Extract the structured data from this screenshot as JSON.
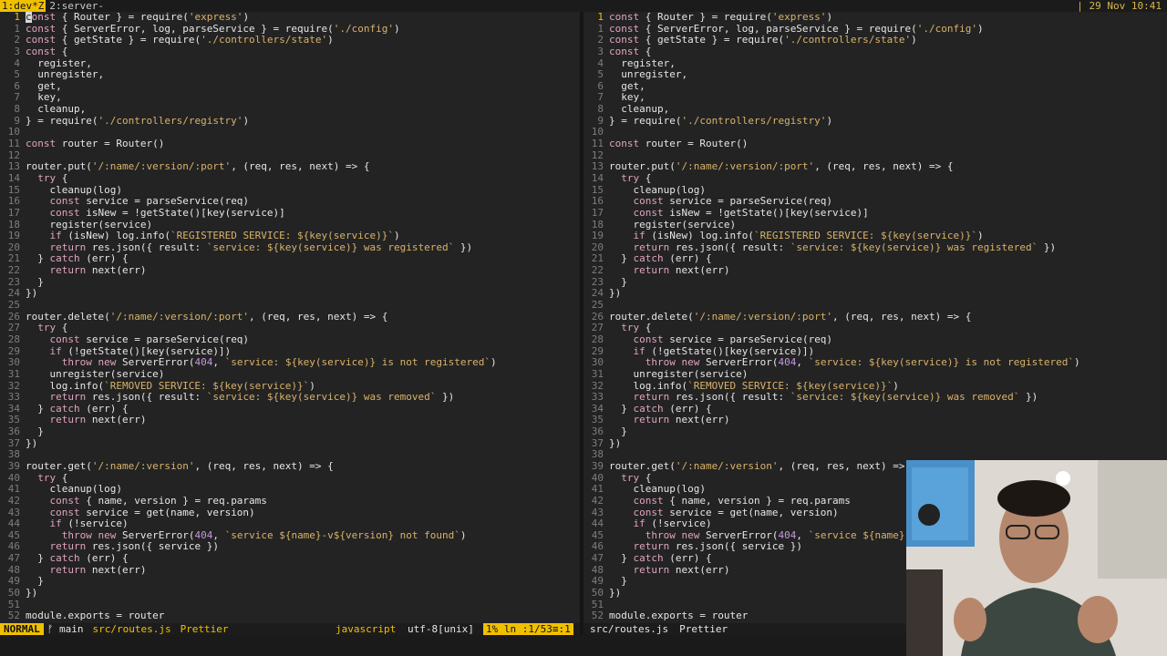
{
  "tmux": {
    "active_window": "1:dev*Z",
    "other_window": "2:server-",
    "date": "| 29 Nov 10:41"
  },
  "left": {
    "status": {
      "mode": "NORMAL",
      "branch": "ᚠ main",
      "file": "src/routes.js",
      "formatter": "Prettier",
      "filetype": "javascript",
      "encoding": "utf-8[unix]",
      "position": "1% ln :1/53≡:1"
    }
  },
  "right": {
    "status": {
      "file": "src/routes.js",
      "formatter": "Prettier"
    }
  },
  "code": [
    {
      "n": "1",
      "t": "const { Router } = require('express')"
    },
    {
      "n": "2",
      "t": "const { ServerError, log, parseService } = require('./config')"
    },
    {
      "n": "3",
      "t": "const { getState } = require('./controllers/state')"
    },
    {
      "n": "4",
      "t": "const {"
    },
    {
      "n": "5",
      "t": "  register,"
    },
    {
      "n": "6",
      "t": "  unregister,"
    },
    {
      "n": "7",
      "t": "  get,"
    },
    {
      "n": "8",
      "t": "  key,"
    },
    {
      "n": "9",
      "t": "  cleanup,"
    },
    {
      "n": "10",
      "t": "} = require('./controllers/registry')"
    },
    {
      "n": "11",
      "t": ""
    },
    {
      "n": "12",
      "t": "const router = Router()"
    },
    {
      "n": "13",
      "t": ""
    },
    {
      "n": "14",
      "t": "router.put('/:name/:version/:port', (req, res, next) => {"
    },
    {
      "n": "15",
      "t": "  try {"
    },
    {
      "n": "16",
      "t": "    cleanup(log)"
    },
    {
      "n": "17",
      "t": "    const service = parseService(req)"
    },
    {
      "n": "18",
      "t": "    const isNew = !getState()[key(service)]"
    },
    {
      "n": "19",
      "t": "    register(service)"
    },
    {
      "n": "20",
      "t": "    if (isNew) log.info(`REGISTERED SERVICE: ${key(service)}`)"
    },
    {
      "n": "21",
      "t": "    return res.json({ result: `service: ${key(service)} was registered` })"
    },
    {
      "n": "22",
      "t": "  } catch (err) {"
    },
    {
      "n": "23",
      "t": "    return next(err)"
    },
    {
      "n": "24",
      "t": "  }"
    },
    {
      "n": "25",
      "t": "})"
    },
    {
      "n": "26",
      "t": ""
    },
    {
      "n": "27",
      "t": "router.delete('/:name/:version/:port', (req, res, next) => {"
    },
    {
      "n": "28",
      "t": "  try {"
    },
    {
      "n": "29",
      "t": "    const service = parseService(req)"
    },
    {
      "n": "30",
      "t": "    if (!getState()[key(service)])"
    },
    {
      "n": "31",
      "t": "      throw new ServerError(404, `service: ${key(service)} is not registered`)"
    },
    {
      "n": "32",
      "t": "    unregister(service)"
    },
    {
      "n": "33",
      "t": "    log.info(`REMOVED SERVICE: ${key(service)}`)"
    },
    {
      "n": "34",
      "t": "    return res.json({ result: `service: ${key(service)} was removed` })"
    },
    {
      "n": "35",
      "t": "  } catch (err) {"
    },
    {
      "n": "36",
      "t": "    return next(err)"
    },
    {
      "n": "37",
      "t": "  }"
    },
    {
      "n": "38",
      "t": "})"
    },
    {
      "n": "39",
      "t": ""
    },
    {
      "n": "40",
      "t": "router.get('/:name/:version', (req, res, next) => {"
    },
    {
      "n": "41",
      "t": "  try {"
    },
    {
      "n": "42",
      "t": "    cleanup(log)"
    },
    {
      "n": "43",
      "t": "    const { name, version } = req.params"
    },
    {
      "n": "44",
      "t": "    const service = get(name, version)"
    },
    {
      "n": "45",
      "t": "    if (!service)"
    },
    {
      "n": "46",
      "t": "      throw new ServerError(404, `service ${name}-v${version} not found`)"
    },
    {
      "n": "47",
      "t": "    return res.json({ service })"
    },
    {
      "n": "48",
      "t": "  } catch (err) {"
    },
    {
      "n": "49",
      "t": "    return next(err)"
    },
    {
      "n": "50",
      "t": "  }"
    },
    {
      "n": "51",
      "t": "})"
    },
    {
      "n": "52",
      "t": ""
    },
    {
      "n": "53",
      "t": "module.exports = router"
    }
  ],
  "left_line_numbers": [
    "1",
    "1",
    "2",
    "3",
    "4",
    "5",
    "6",
    "7",
    "8",
    "9",
    "10",
    "11",
    "12",
    "13",
    "14",
    "15",
    "16",
    "17",
    "18",
    "19",
    "20",
    "21",
    "22",
    "23",
    "24",
    "25",
    "26",
    "27",
    "28",
    "29",
    "30",
    "31",
    "32",
    "33",
    "34",
    "35",
    "36",
    "37",
    "38",
    "39",
    "40",
    "41",
    "42",
    "43",
    "44",
    "45",
    "46",
    "47",
    "48",
    "49",
    "50",
    "51",
    "52"
  ],
  "right_line_numbers": [
    "1",
    "1",
    "2",
    "3",
    "4",
    "5",
    "6",
    "7",
    "8",
    "9",
    "10",
    "11",
    "12",
    "13",
    "14",
    "15",
    "16",
    "17",
    "18",
    "19",
    "20",
    "21",
    "22",
    "23",
    "24",
    "25",
    "26",
    "27",
    "28",
    "29",
    "30",
    "31",
    "32",
    "33",
    "34",
    "35",
    "36",
    "37",
    "38",
    "39",
    "40",
    "41",
    "42",
    "43",
    "44",
    "45",
    "46",
    "47",
    "48",
    "49",
    "50",
    "51",
    "52"
  ],
  "colors": {
    "background": "#232323",
    "accent_yellow": "#f0c000",
    "keyword": "#e0a3c0",
    "string": "#d9b36a",
    "number": "#c497e0",
    "line_number": "#7d7d7d"
  }
}
